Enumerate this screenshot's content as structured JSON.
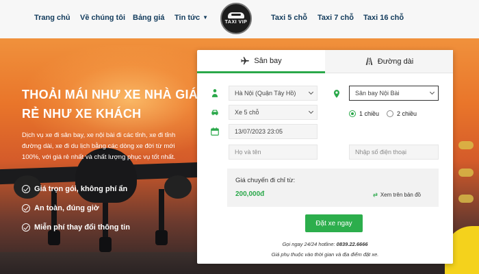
{
  "nav": {
    "items": [
      "Trang chủ",
      "Về chúng tôi",
      "Bảng giá",
      "Tin tức",
      "Taxi 5 chỗ",
      "Taxi 7 chỗ",
      "Taxi 16 chỗ"
    ],
    "logo_text": "TAXI VIP"
  },
  "hero": {
    "title": "THOẢI MÁI NHƯ XE NHÀ GIÁ RẺ NHƯ XE KHÁCH",
    "description": "Dịch vụ xe đi sân bay, xe nội bài đi các tỉnh, xe đi tỉnh đường dài, xe đi du lịch bằng các dòng xe đời từ mới 100%, với giá rẻ nhất và chất lượng phục vụ tốt nhất.",
    "features": [
      "Giá trọn gói, không phí ẩn",
      "An toàn, đúng giờ",
      "Miễn phí thay đổi thông tin"
    ]
  },
  "booking": {
    "tabs": [
      "Sân bay",
      "Đường dài"
    ],
    "pickup": "Hà Nội (Quận Tây Hồ)",
    "destination": "Sân bay Nội Bài",
    "car_type": "Xe 5 chỗ",
    "datetime": "13/07/2023 23:05",
    "trip_options": [
      "1 chiều",
      "2 chiều"
    ],
    "name_placeholder": "Họ và tên",
    "phone_placeholder": "Nhập số điện thoại",
    "price_label": "Giá chuyến đi chỉ từ:",
    "price_value": "200,000đ",
    "map_link": "Xem trên bản đồ",
    "book_button": "Đặt xe ngay",
    "hotline_label": "Gọi ngay 24/24 hotline:",
    "hotline_number": "0839.22.6666",
    "note": "Giá phụ thuộc vào thời gian và địa điểm đặt xe."
  },
  "colors": {
    "accent": "#2aa84a",
    "nav_text": "#123b5c"
  }
}
